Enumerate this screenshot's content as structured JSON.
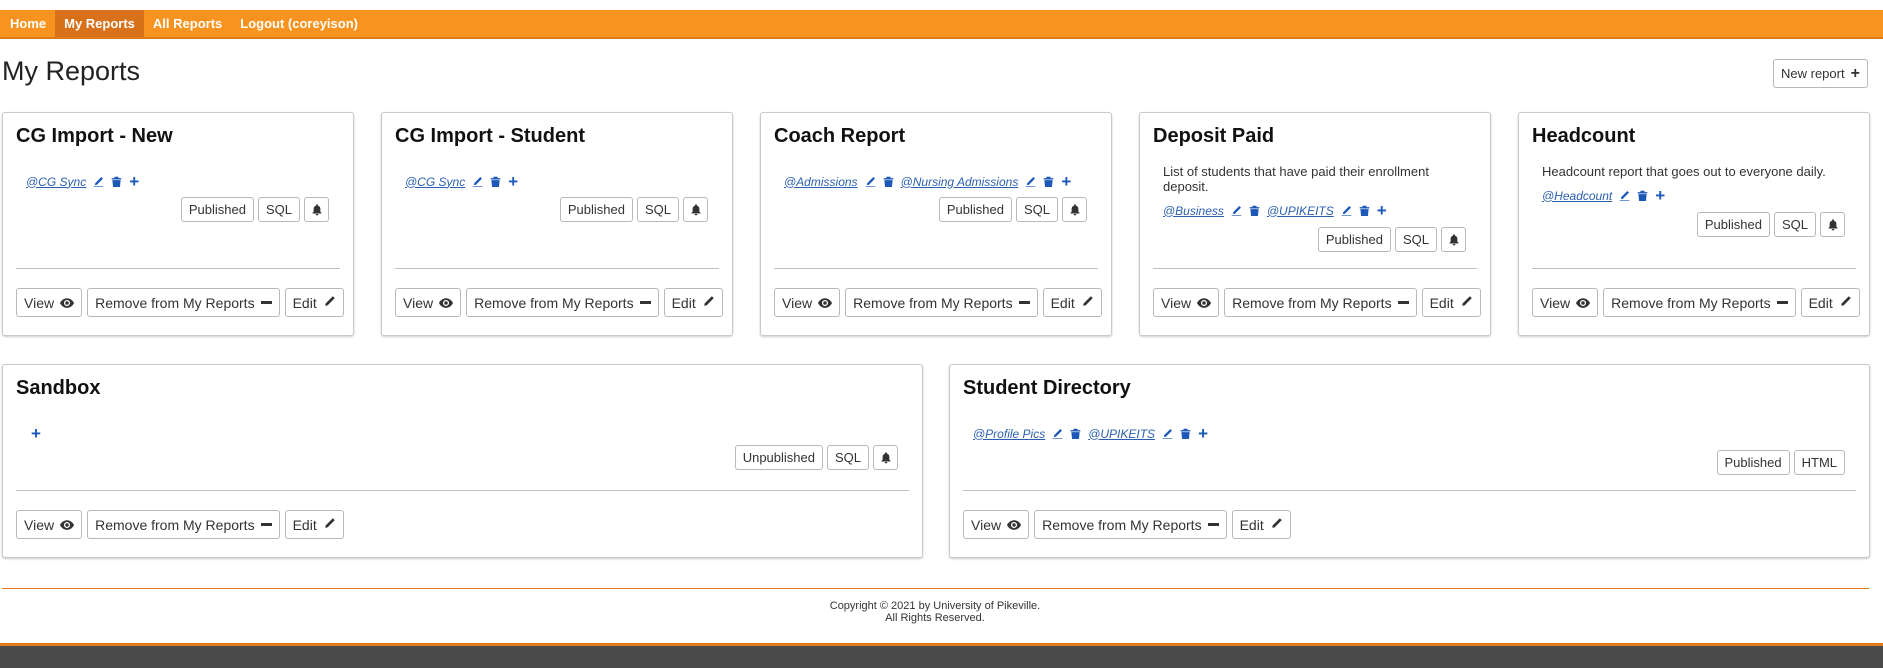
{
  "nav": {
    "items": [
      {
        "label": "Home",
        "active": false
      },
      {
        "label": "My Reports",
        "active": true
      },
      {
        "label": "All Reports",
        "active": false
      },
      {
        "label": "Logout (coreyison)",
        "active": false
      }
    ]
  },
  "page": {
    "title": "My Reports",
    "new_report_label": "New report"
  },
  "cards": [
    {
      "title": "CG Import - New",
      "description": "",
      "tags": [
        "@CG Sync"
      ],
      "badges": [
        "Published",
        "SQL"
      ]
    },
    {
      "title": "CG Import - Student",
      "description": "",
      "tags": [
        "@CG Sync"
      ],
      "badges": [
        "Published",
        "SQL"
      ]
    },
    {
      "title": "Coach Report",
      "description": "",
      "tags": [
        "@Admissions",
        "@Nursing Admissions"
      ],
      "badges": [
        "Published",
        "SQL"
      ]
    },
    {
      "title": "Deposit Paid",
      "description": "List of students that have paid their enrollment deposit.",
      "tags": [
        "@Business",
        "@UPIKEITS"
      ],
      "badges": [
        "Published",
        "SQL"
      ]
    },
    {
      "title": "Headcount",
      "description": "Headcount report that goes out to everyone daily.",
      "tags": [
        "@Headcount"
      ],
      "badges": [
        "Published",
        "SQL"
      ]
    },
    {
      "title": "Sandbox",
      "description": "",
      "tags": [],
      "badges": [
        "Unpublished",
        "SQL"
      ]
    },
    {
      "title": "Student Directory",
      "description": "",
      "tags": [
        "@Profile Pics",
        "@UPIKEITS"
      ],
      "badges": [
        "Published",
        "HTML"
      ]
    }
  ],
  "card_actions": {
    "view": "View",
    "remove": "Remove from My Reports",
    "edit": "Edit"
  },
  "footer": {
    "copyright": "Copyright © 2021 by University of Pikeville.",
    "rights": "All Rights Reserved."
  },
  "colors": {
    "nav_bg": "#f7931e",
    "nav_active": "#d9711a",
    "link": "#2a5fb0",
    "icon_blue": "#1b58b8"
  }
}
